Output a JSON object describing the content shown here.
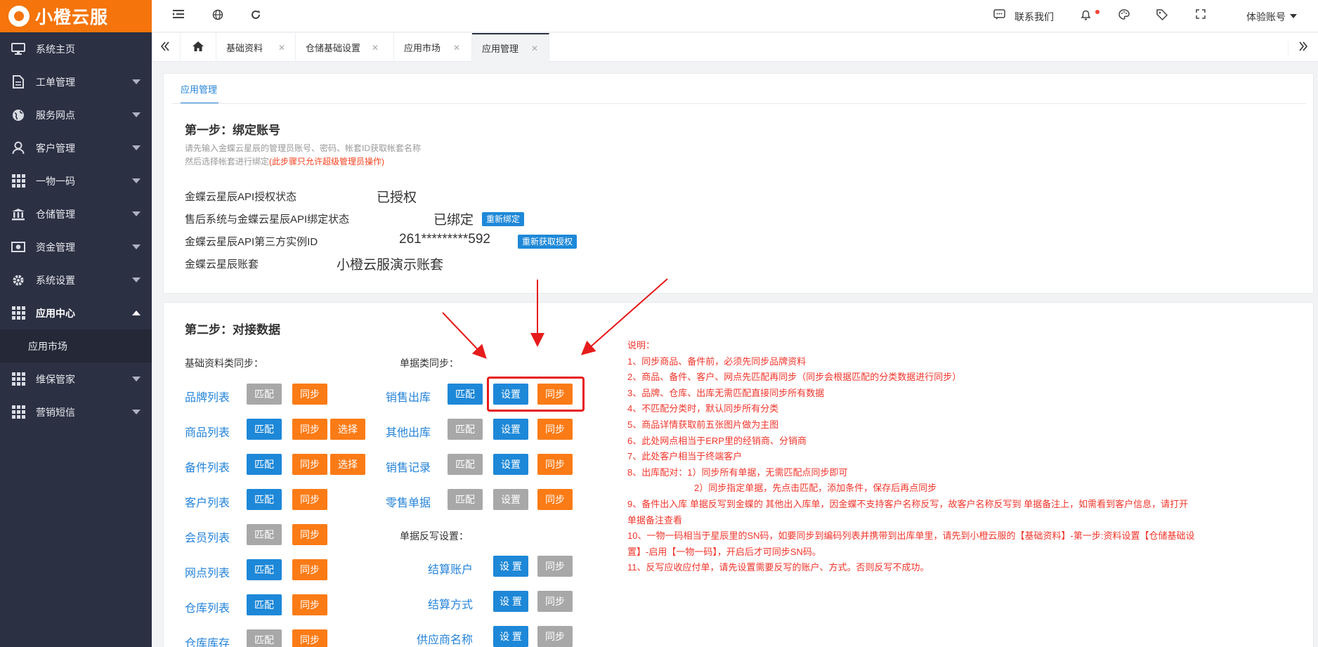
{
  "app": {
    "logo_text": "小橙云服"
  },
  "sidebar": {
    "items": [
      {
        "label": "系统主页",
        "icon": "monitor-icon",
        "has_caret": false
      },
      {
        "label": "工单管理",
        "icon": "document-icon",
        "has_caret": true
      },
      {
        "label": "服务网点",
        "icon": "globe-icon",
        "has_caret": true
      },
      {
        "label": "客户管理",
        "icon": "user-icon",
        "has_caret": true
      },
      {
        "label": "一物一码",
        "icon": "grid-icon",
        "has_caret": true
      },
      {
        "label": "仓储管理",
        "icon": "bank-icon",
        "has_caret": true
      },
      {
        "label": "资金管理",
        "icon": "money-icon",
        "has_caret": true
      },
      {
        "label": "系统设置",
        "icon": "gear-icon",
        "has_caret": true
      },
      {
        "label": "应用中心",
        "icon": "grid-icon",
        "has_caret": true,
        "expanded": true
      },
      {
        "label": "维保管家",
        "icon": "grid-icon",
        "has_caret": true
      },
      {
        "label": "营销短信",
        "icon": "grid-icon",
        "has_caret": true
      }
    ],
    "sub_items": [
      {
        "label": "应用市场"
      }
    ]
  },
  "topbar": {
    "contact_label": "联系我们",
    "account_label": "体验账号"
  },
  "tabs": {
    "items": [
      {
        "label": "基础资料"
      },
      {
        "label": "仓储基础设置"
      },
      {
        "label": "应用市场"
      },
      {
        "label": "应用管理"
      }
    ]
  },
  "page": {
    "inner_tab": "应用管理",
    "step1": {
      "title": "第一步：绑定账号",
      "hint1": "请先输入金蝶云星辰的管理员账号、密码、帐套ID获取帐套名称",
      "hint2": "然后选择帐套进行绑定",
      "hint2_red": "(此步骤只允许超级管理员操作)",
      "rows": [
        {
          "label": "金蝶云星辰API授权状态",
          "value": "已授权"
        },
        {
          "label": "售后系统与金蝶云星辰API绑定状态",
          "value": "已绑定",
          "button": "重新绑定"
        },
        {
          "label": "金蝶云星辰API第三方实例ID",
          "value": "261*********592",
          "button": "重新获取授权"
        },
        {
          "label": "金蝶云星辰账套",
          "value": "小橙云服演示账套"
        }
      ]
    },
    "step2": {
      "title": "第二步：对接数据",
      "basic_head": "基础资料类同步：",
      "doc_head": "单据类同步：",
      "writeback_head": "单据反写设置：",
      "match_label": "匹配",
      "sync_label": "同步",
      "select_label": "选择",
      "set_label": "设置",
      "set_label_spaced": "设 置",
      "basic_rows": [
        {
          "label": "品牌列表",
          "match": "grey",
          "select": false
        },
        {
          "label": "商品列表",
          "match": "blue",
          "select": true
        },
        {
          "label": "备件列表",
          "match": "blue",
          "select": true
        },
        {
          "label": "客户列表",
          "match": "blue",
          "select": false
        },
        {
          "label": "会员列表",
          "match": "grey",
          "select": false
        },
        {
          "label": "网点列表",
          "match": "blue",
          "select": false
        },
        {
          "label": "仓库列表",
          "match": "blue",
          "select": false
        },
        {
          "label": "仓库库存",
          "match": "grey",
          "select": false
        }
      ],
      "doc_rows": [
        {
          "label": "销售出库",
          "match": "blue",
          "set": "blue"
        },
        {
          "label": "其他出库",
          "match": "grey",
          "set": "blue"
        },
        {
          "label": "销售记录",
          "match": "grey",
          "set": "blue"
        },
        {
          "label": "零售单据",
          "match": "grey",
          "set": "grey"
        }
      ],
      "writeback_rows": [
        {
          "label": "结算账户"
        },
        {
          "label": "结算方式"
        },
        {
          "label": "供应商名称"
        }
      ],
      "notes": [
        "说明：",
        "1、同步商品、备件前，必须先同步品牌资料",
        "2、商品、备件、客户、网点先匹配再同步（同步会根据匹配的分类数据进行同步）",
        "3、品牌、仓库、出库无需匹配直接同步所有数据",
        "4、不匹配分类时，默认同步所有分类",
        "5、商品详情获取前五张图片做为主图",
        "6、此处网点相当于ERP里的经销商、分销商",
        "7、此处客户相当于终端客户",
        "8、出库配对：1）同步所有单据，无需匹配点同步即可",
        "2）同步指定单据，先点击匹配，添加条件，保存后再点同步",
        "9、备件出入库 单据反写到金蝶的 其他出入库单，因金蝶不支持客户名称反写，故客户名称反写到 单据备注上，如需看到客户信息，请打开",
        "单据备注查看",
        "10、一物一码相当于星辰里的SN码，如要同步到编码列表并携带到出库单里，请先到小橙云服的【基础资料】-第一步:资料设置【仓储基础设",
        "置】-启用【一物一码】，开启后才可同步SN码。",
        "11、反写应收应付单，请先设置需要反写的账户、方式。否则反写不成功。"
      ]
    }
  },
  "colors": {
    "accent": "#f5740b",
    "sidebar": "#2b3043",
    "link": "#2483d9",
    "blue_btn": "#1e88d8",
    "orange_btn": "#fb7b16",
    "grey_btn": "#a8a8a8",
    "notes": "#f0352b"
  }
}
